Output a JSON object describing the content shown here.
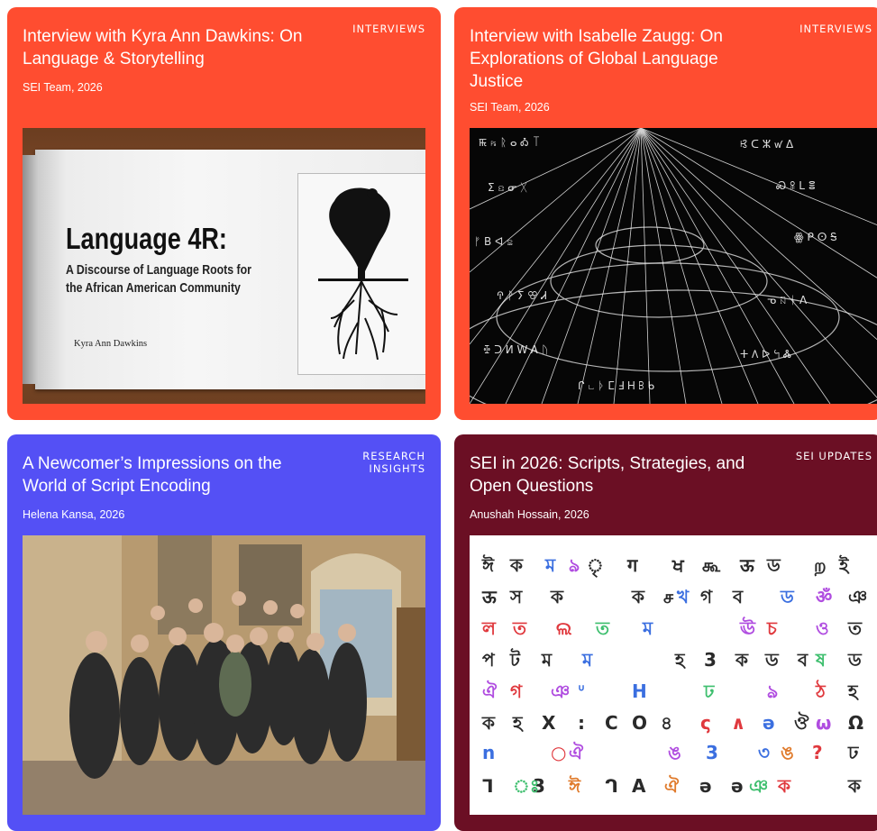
{
  "cards": [
    {
      "title": "Interview with Kyra Ann Dawkins: On Language & Storytelling",
      "tag": "INTERVIEWS",
      "meta": "SEI Team, 2026",
      "color": "#ff4d30",
      "image": {
        "book_title": "Language 4R:",
        "book_subtitle_line1": "A Discourse of Language Roots for",
        "book_subtitle_line2": "the African American Community",
        "book_author": "Kyra Ann  Dawkins"
      }
    },
    {
      "title": "Interview with Isabelle Zaugg: On Explorations of Global Language Justice",
      "tag": "INTERVIEWS",
      "meta": "SEI Team, 2026",
      "color": "#ff4d30"
    },
    {
      "title": "A Newcomer’s Impressions on the World of Script Encoding",
      "tag": "RESEARCH INSIGHTS",
      "meta": "Helena Kansa, 2026",
      "color": "#5450f5"
    },
    {
      "title": "SEI in 2026: Scripts, Strategies, and Open Questions",
      "tag": "SEI UPDATES",
      "meta": "Anushah Hossain, 2026",
      "color": "#6b0f24"
    }
  ]
}
